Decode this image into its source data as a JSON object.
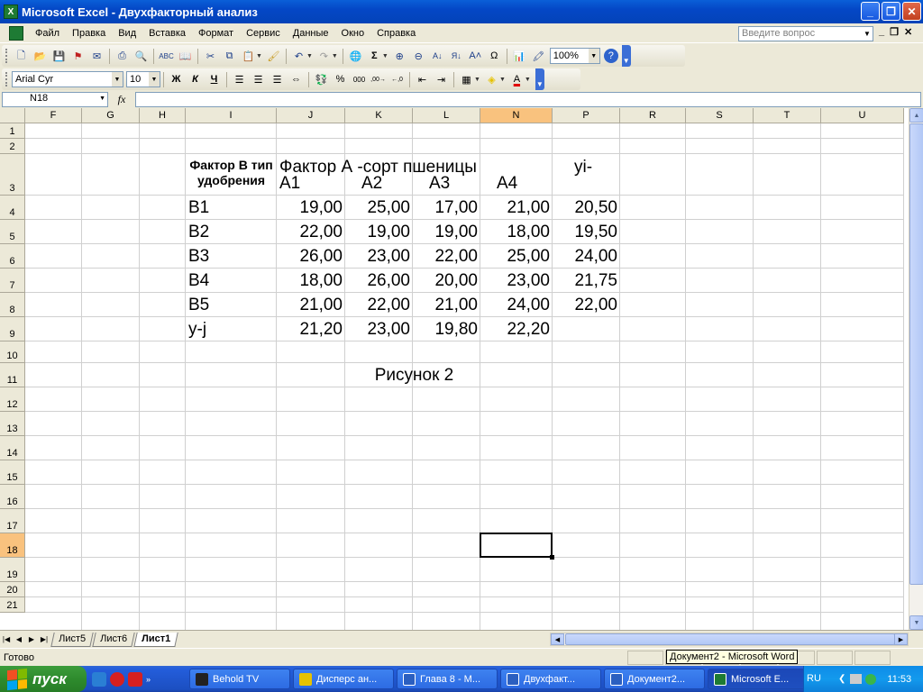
{
  "window": {
    "title": "Microsoft Excel - Двухфакторный анализ",
    "minimize": "_",
    "restore": "❐",
    "close": "✕"
  },
  "menu": {
    "items": [
      "Файл",
      "Правка",
      "Вид",
      "Вставка",
      "Формат",
      "Сервис",
      "Данные",
      "Окно",
      "Справка"
    ],
    "question_placeholder": "Введите вопрос"
  },
  "toolbar_standard": {
    "zoom": "100%"
  },
  "toolbar_format": {
    "font": "Arial Cyr",
    "size": "10",
    "bold": "Ж",
    "italic": "К",
    "underline": "Ч"
  },
  "formula_bar": {
    "name_box": "N18",
    "fx": "fx",
    "value": ""
  },
  "columns": [
    "F",
    "G",
    "H",
    "I",
    "J",
    "K",
    "L",
    "N",
    "P",
    "R",
    "S",
    "T",
    "U"
  ],
  "rows": [
    "1",
    "2",
    "3",
    "4",
    "5",
    "6",
    "7",
    "8",
    "9",
    "10",
    "11",
    "12",
    "13",
    "14",
    "15",
    "16",
    "17",
    "18",
    "19",
    "20",
    "21"
  ],
  "active_cell": {
    "column": "N",
    "row": "18"
  },
  "sheet": {
    "header_factor_b": "Фактор В тип удобрения",
    "header_factor_a": "Фактор А -сорт пшеницы",
    "header_yi": "yi-",
    "col_labels": [
      "А1",
      "А2",
      "А3",
      "А4"
    ],
    "data_rows": [
      {
        "label": "В1",
        "values": [
          "19,00",
          "25,00",
          "17,00",
          "21,00"
        ],
        "mean": "20,50"
      },
      {
        "label": "В2",
        "values": [
          "22,00",
          "19,00",
          "19,00",
          "18,00"
        ],
        "mean": "19,50"
      },
      {
        "label": "В3",
        "values": [
          "26,00",
          "23,00",
          "22,00",
          "25,00"
        ],
        "mean": "24,00"
      },
      {
        "label": "В4",
        "values": [
          "18,00",
          "26,00",
          "20,00",
          "23,00"
        ],
        "mean": "21,75"
      },
      {
        "label": "В5",
        "values": [
          "21,00",
          "22,00",
          "21,00",
          "24,00"
        ],
        "mean": "22,00"
      }
    ],
    "mean_row": {
      "label": "y-j",
      "values": [
        "21,20",
        "23,00",
        "19,80",
        "22,20"
      ]
    },
    "caption": "Рисунок 2"
  },
  "sheet_tabs": [
    "Лист5",
    "Лист6",
    "Лист1"
  ],
  "active_sheet": "Лист1",
  "status": {
    "text": "Готово",
    "tooltip": "Документ2 - Microsoft Word"
  },
  "taskbar": {
    "start": "пуск",
    "tasks": [
      "Behold TV",
      "Дисперс ан...",
      "Глава 8 - М...",
      "Двухфакт...",
      "Документ2...",
      "Microsoft E..."
    ],
    "active_task": "Microsoft E...",
    "lang": "RU",
    "clock": "11:53"
  },
  "colors": {
    "accent": "#0a5fd8",
    "active_header": "#f9c27e"
  }
}
